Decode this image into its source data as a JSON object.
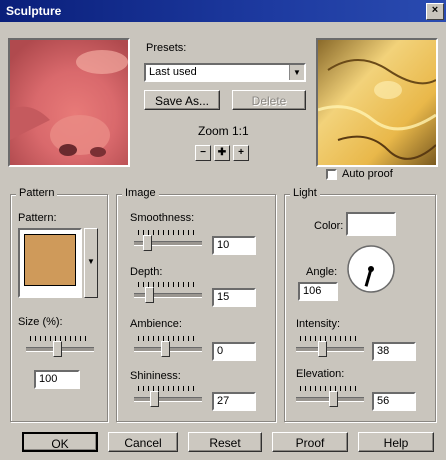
{
  "window": {
    "title": "Sculpture",
    "close_label": "×"
  },
  "presets": {
    "label": "Presets:",
    "value": "Last used",
    "save_as": "Save As...",
    "delete": "Delete"
  },
  "zoom": {
    "label": "Zoom 1:1",
    "zoom_out": "−",
    "pan": "✚",
    "zoom_in": "+"
  },
  "auto_proof": {
    "label": "Auto proof",
    "checked": false
  },
  "pattern": {
    "group_title": "Pattern",
    "pattern_label": "Pattern:",
    "swatch_color": "#cf9a5a",
    "size_label": "Size (%):",
    "size_value": "100",
    "size_level": 0.45
  },
  "image": {
    "group_title": "Image",
    "smoothness_label": "Smoothness:",
    "smoothness_value": "10",
    "smoothness_level": 0.15,
    "depth_label": "Depth:",
    "depth_value": "15",
    "depth_level": 0.18,
    "ambience_label": "Ambience:",
    "ambience_value": "0",
    "ambience_level": 0.45,
    "shininess_label": "Shininess:",
    "shininess_value": "27",
    "shininess_level": 0.27
  },
  "light": {
    "group_title": "Light",
    "color_label": "Color:",
    "angle_label": "Angle:",
    "angle_value": "106",
    "intensity_label": "Intensity:",
    "intensity_value": "38",
    "intensity_level": 0.38,
    "elevation_label": "Elevation:",
    "elevation_value": "56",
    "elevation_level": 0.56
  },
  "buttons": {
    "ok": "OK",
    "cancel": "Cancel",
    "reset": "Reset",
    "proof": "Proof",
    "help": "Help"
  }
}
